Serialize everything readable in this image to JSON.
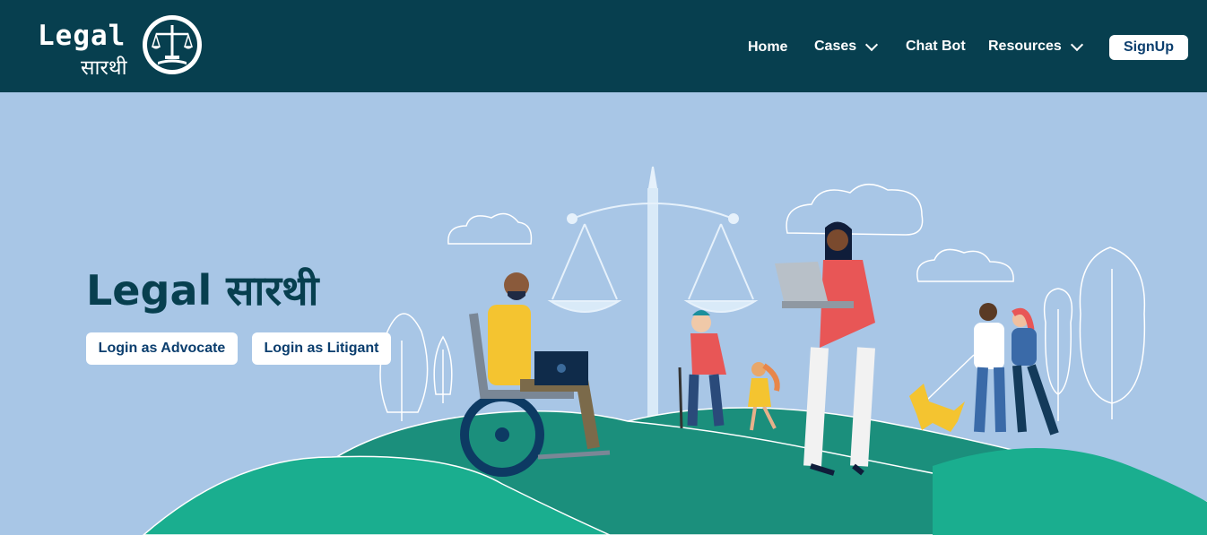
{
  "brand": {
    "word": "Legal",
    "subword": "सारथी"
  },
  "nav": {
    "home": "Home",
    "cases": "Cases",
    "chatbot": "Chat Bot",
    "resources": "Resources",
    "signup": "SignUp"
  },
  "hero": {
    "title": "Legal सारथी",
    "login_advocate": "Login as Advocate",
    "login_litigant": "Login as Litigant"
  },
  "icons": [
    "scales-of-justice-icon",
    "chevron-down-icon"
  ],
  "colors": {
    "header_bg": "#073f4f",
    "hero_bg": "#a8c6e6",
    "hill_green": "#1aae8f",
    "button_text": "#0b3e6e"
  }
}
